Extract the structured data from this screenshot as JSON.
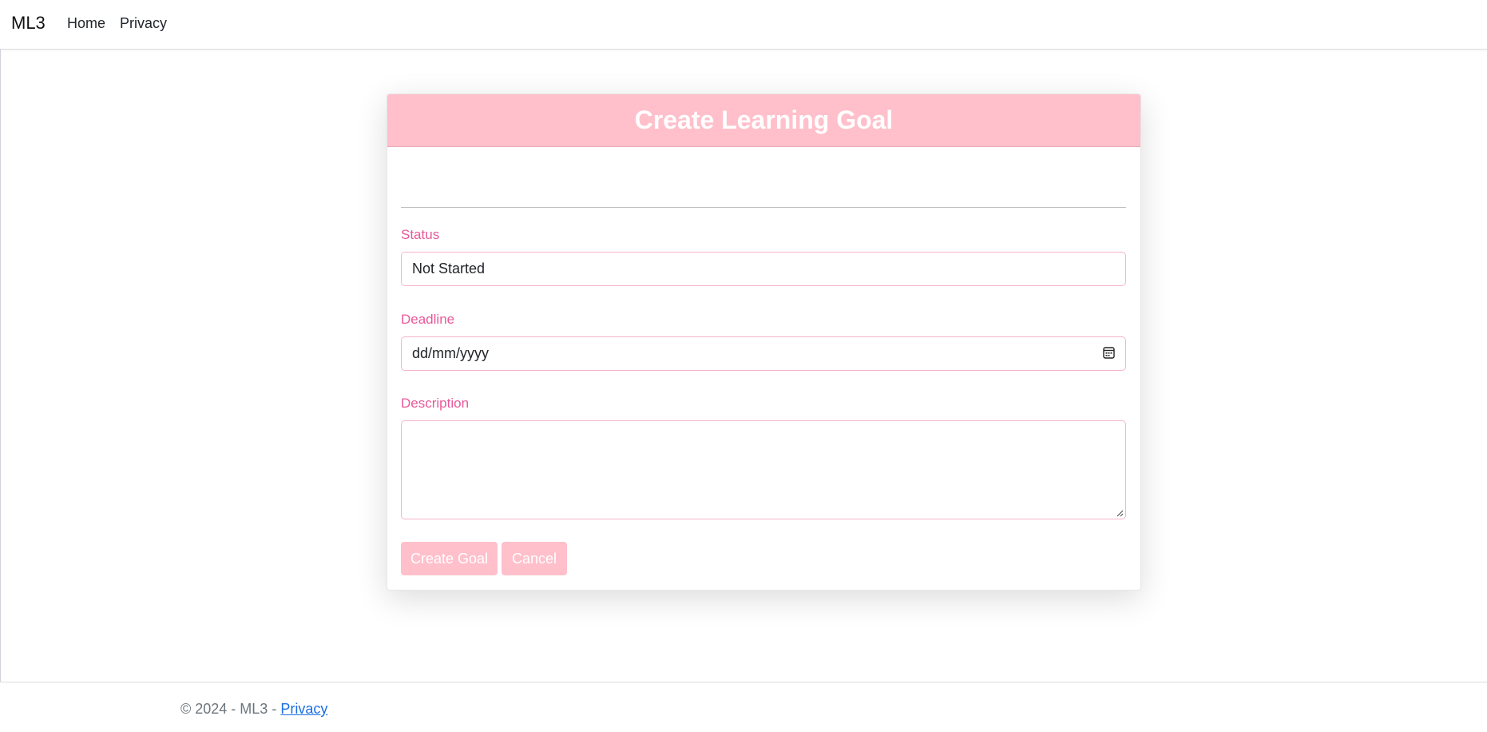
{
  "navbar": {
    "brand": "ML3",
    "links": [
      {
        "label": "Home"
      },
      {
        "label": "Privacy"
      }
    ]
  },
  "form": {
    "title": "Create Learning Goal",
    "status": {
      "label": "Status",
      "value": "Not Started"
    },
    "deadline": {
      "label": "Deadline",
      "placeholder": "dd/mm/yyyy"
    },
    "description": {
      "label": "Description",
      "value": ""
    },
    "buttons": {
      "create_label": "Create Goal",
      "cancel_label": "Cancel"
    }
  },
  "footer": {
    "text": "© 2024 - ML3 - ",
    "link_label": "Privacy"
  },
  "colors": {
    "accent_pink": "#ffc0cb",
    "label_pink": "#e8589a",
    "border_pink": "#f5b5c8",
    "link_blue": "#1a6fe0"
  },
  "icons": {
    "deadline_picker": "calendar-icon",
    "textarea_resize": "resize-handle-icon"
  }
}
